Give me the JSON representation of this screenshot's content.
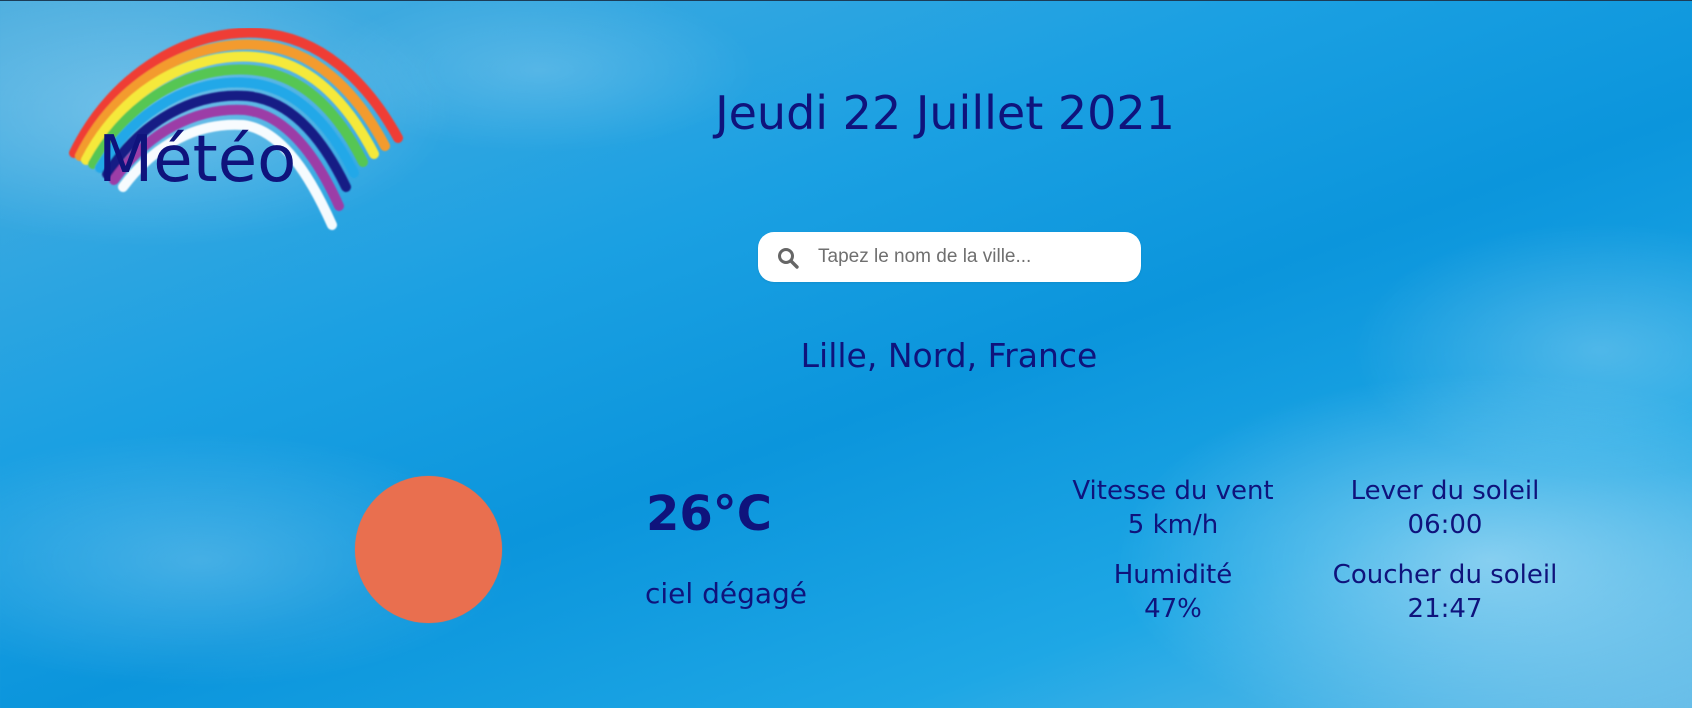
{
  "header": {
    "app_title": "Météo",
    "date": "Jeudi 22 Juillet 2021"
  },
  "search": {
    "placeholder": "Tapez le nom de la ville...",
    "icon": "search-icon"
  },
  "location": {
    "name": "Lille, Nord, France"
  },
  "weather": {
    "icon": "sun-icon",
    "temperature": "26°C",
    "description": "ciel dégagé"
  },
  "details": {
    "wind_label": "Vitesse du vent",
    "wind_value": "5 km/h",
    "humidity_label": "Humidité",
    "humidity_value": "47%",
    "sunrise_label": "Lever du soleil",
    "sunrise_value": "06:00",
    "sunset_label": "Coucher du soleil",
    "sunset_value": "21:47"
  },
  "colors": {
    "sky_blue": "#0b95dc",
    "text_navy": "#0f137c",
    "sun_orange": "#e96f4f",
    "search_background": "#ffffff"
  }
}
